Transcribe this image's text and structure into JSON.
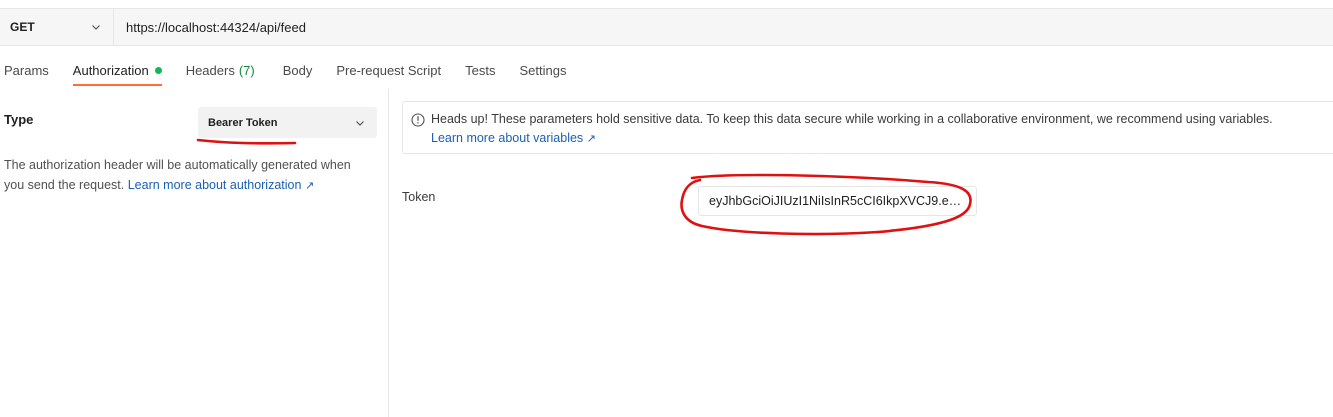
{
  "request": {
    "method": "GET",
    "url": "https://localhost:44324/api/feed"
  },
  "tabs": [
    {
      "label": "Params"
    },
    {
      "label": "Authorization"
    },
    {
      "label": "Headers",
      "count": "(7)"
    },
    {
      "label": "Body"
    },
    {
      "label": "Pre-request Script"
    },
    {
      "label": "Tests"
    },
    {
      "label": "Settings"
    }
  ],
  "auth": {
    "type_label": "Type",
    "type_value": "Bearer Token",
    "description": "The authorization header will be automatically generated when you send the request.",
    "learn_more": "Learn more about authorization",
    "learn_more_arrow": "↗"
  },
  "notice": {
    "message": "Heads up! These parameters hold sensitive data. To keep this data secure while working in a collaborative environment, we recommend using variables.",
    "learn_more": "Learn more about variables",
    "learn_more_arrow": "↗"
  },
  "token": {
    "label": "Token",
    "value": "eyJhbGciOiJIUzI1NiIsInR5cCI6IkpXVCJ9.eyJ..."
  },
  "colors": {
    "active_tab_underline": "#ff6c37",
    "status_dot": "#0cbb52",
    "link": "#1b5fb5",
    "annotation": "#e01010"
  }
}
